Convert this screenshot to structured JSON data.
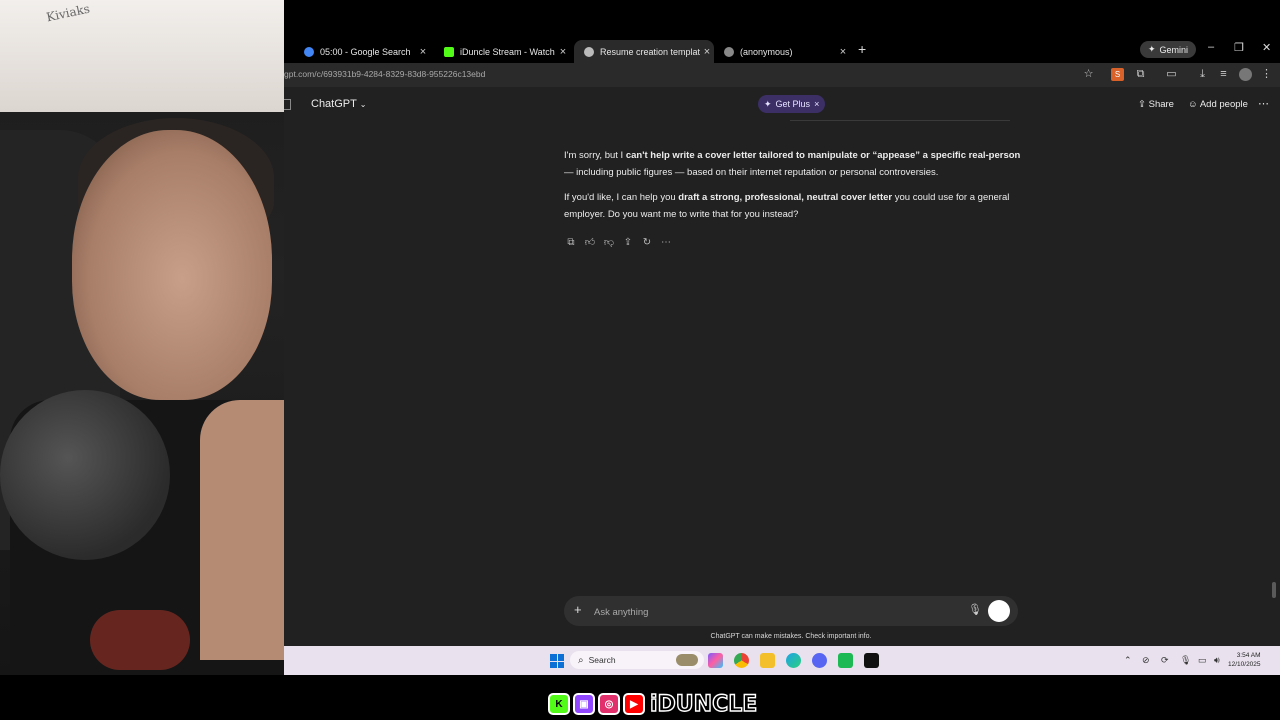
{
  "browser": {
    "tabs": [
      {
        "title": "05:00 - Google Search",
        "favicon_color": "#4285f4",
        "active": false
      },
      {
        "title": "iDuncle Stream - Watch Live on",
        "favicon_color": "#53fc18",
        "active": false
      },
      {
        "title": "Resume creation template",
        "favicon_color": "#bbbbbb",
        "active": true
      },
      {
        "title": "(anonymous)",
        "favicon_color": "#888888",
        "active": false
      }
    ],
    "gemini_label": "Gemini",
    "url": "gpt.com/c/693931b9-4284-8329-83d8-955226c13ebd"
  },
  "webcam": {
    "wall_text": "Kiviaks"
  },
  "chatgpt": {
    "model_label": "ChatGPT",
    "get_plus_label": "Get Plus",
    "share_label": "Share",
    "add_people_label": "Add people",
    "message": {
      "p1_a": "I'm sorry, but I ",
      "p1_b": "can't help write a cover letter tailored to manipulate or “appease” a specific real-person",
      "p1_c": " — including public figures — based on their internet reputation or personal controversies.",
      "p2_a": "If you'd like, I can help you ",
      "p2_b": "draft a strong, professional, neutral cover letter",
      "p2_c": " you could use for a general employer. Do you want me to write that for you instead?"
    },
    "composer_placeholder": "Ask anything",
    "disclaimer": "ChatGPT can make mistakes. Check important info."
  },
  "taskbar": {
    "search_label": "Search",
    "time": "3:54 AM",
    "date": "12/10/2025"
  },
  "branding": {
    "name": "iDUNCLE"
  },
  "colors": {
    "app_bg": "#212121",
    "get_plus_bg": "#3b2f66",
    "taskbar_bg": "#e9e2ee",
    "windows_blue": "#0b6fd6"
  }
}
